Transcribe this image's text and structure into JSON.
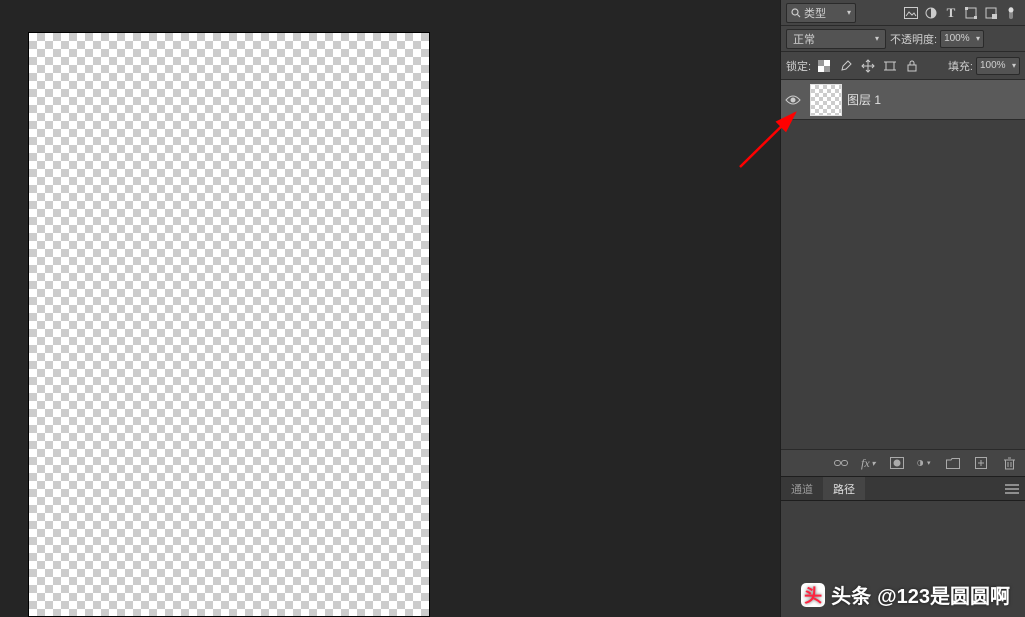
{
  "layers_panel": {
    "filter": {
      "kind_label": "类型",
      "icons": [
        "image-filter-icon",
        "adjustment-filter-icon",
        "type-filter-icon",
        "shape-filter-icon",
        "smartobject-filter-icon"
      ]
    },
    "blend": {
      "mode": "正常",
      "opacity_label": "不透明度:",
      "opacity_value": "100%"
    },
    "lock": {
      "label": "锁定:",
      "fill_label": "填充:",
      "fill_value": "100%"
    },
    "layers": [
      {
        "name": "图层 1",
        "visible": true
      }
    ],
    "tabs": {
      "channels": "通道",
      "paths": "路径"
    }
  },
  "watermark": {
    "prefix": "头条",
    "handle": "@123是圆圆啊"
  }
}
